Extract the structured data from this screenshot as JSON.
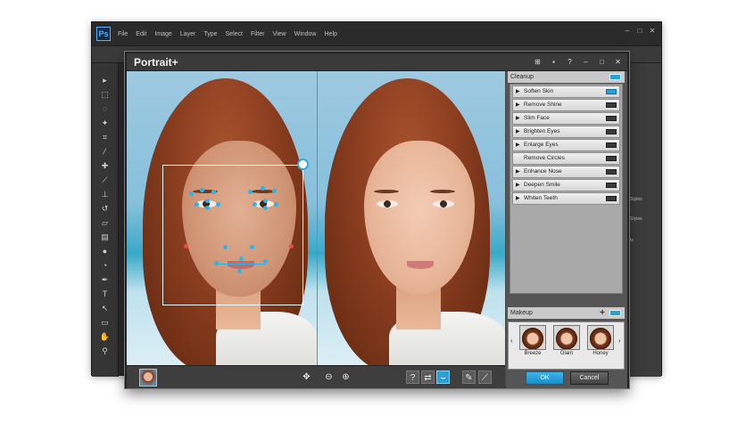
{
  "photoshop": {
    "logo": "Ps",
    "menu": [
      "File",
      "Edit",
      "Image",
      "Layer",
      "Type",
      "Select",
      "Filter",
      "View",
      "Window",
      "Help"
    ],
    "window_controls": [
      "–",
      "□",
      "✕"
    ],
    "tools": [
      "pointer-tool-icon",
      "marquee-tool-icon",
      "lasso-tool-icon",
      "wand-tool-icon",
      "crop-tool-icon",
      "eyedropper-tool-icon",
      "heal-tool-icon",
      "brush-tool-icon",
      "stamp-tool-icon",
      "history-brush-tool-icon",
      "eraser-tool-icon",
      "gradient-tool-icon",
      "blur-tool-icon",
      "dodge-tool-icon",
      "pen-tool-icon",
      "type-tool-icon",
      "path-select-tool-icon",
      "shape-tool-icon",
      "hand-tool-icon",
      "zoom-tool-icon"
    ],
    "right_panel_labels": [
      "Styles",
      "Styles",
      "ts"
    ]
  },
  "dialog": {
    "title": "Portrait+",
    "title_icons": [
      "grid-icon",
      "chat-icon",
      "help-icon",
      "minimize-icon",
      "maximize-icon",
      "close-icon"
    ],
    "title_icon_glyphs": [
      "⊞",
      "▪",
      "?",
      "–",
      "□",
      "✕"
    ]
  },
  "cleanup": {
    "header": "Cleanup",
    "header_toggle_on": true,
    "items": [
      {
        "label": "Soften Skin",
        "on": true,
        "arrow": true
      },
      {
        "label": "Remove Shine",
        "on": false,
        "arrow": true
      },
      {
        "label": "Slim Face",
        "on": false,
        "arrow": true
      },
      {
        "label": "Brighten Eyes",
        "on": false,
        "arrow": true
      },
      {
        "label": "Enlarge Eyes",
        "on": false,
        "arrow": true
      },
      {
        "label": "Remove Circles",
        "on": false,
        "arrow": false
      },
      {
        "label": "Enhance Nose",
        "on": false,
        "arrow": true
      },
      {
        "label": "Deepen Smile",
        "on": false,
        "arrow": true
      },
      {
        "label": "Whiten Teeth",
        "on": false,
        "arrow": true
      }
    ]
  },
  "makeup": {
    "header": "Makeup",
    "plus": "+",
    "left_arrow": "‹",
    "right_arrow": "›",
    "presets": [
      "Breeze",
      "Glam",
      "Honey"
    ]
  },
  "photo_toolbar": {
    "fit_glyph": "✥",
    "zoom_out_glyph": "⊖",
    "zoom_in_glyph": "⊕",
    "help_glyph": "?",
    "split_glyph": "⇄",
    "landmarks_glyph": "⌣",
    "eraser_glyph": "✎",
    "brush_glyph": "⟋"
  },
  "buttons": {
    "ok": "OK",
    "cancel": "Cancel"
  },
  "colors": {
    "accent": "#2a9fd8",
    "landmark": "#2cb6e8",
    "landmark_alt": "#e0504a"
  }
}
